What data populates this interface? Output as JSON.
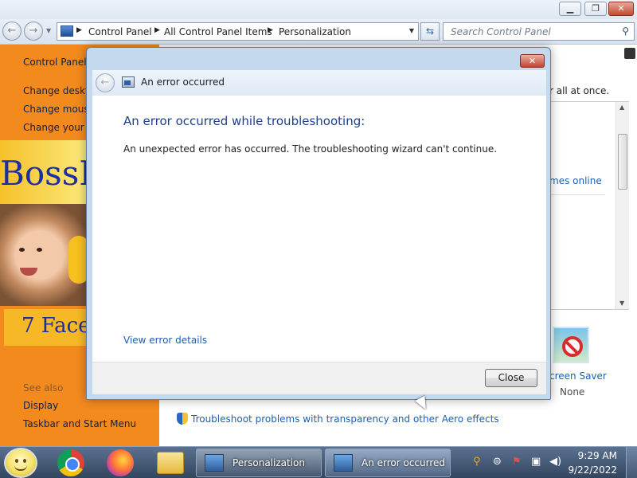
{
  "explorer": {
    "address_crumbs": [
      "Control Panel",
      "All Control Panel Items",
      "Personalization"
    ],
    "search_placeholder": "Search Control Panel",
    "left_pane": {
      "home_link": "Control Panel H",
      "links": [
        "Change deskto",
        "Change mouse",
        "Change your a"
      ],
      "see_also_label": "See also",
      "see_also_links": [
        "Display",
        "Taskbar and Start Menu"
      ]
    },
    "background_images": {
      "banner_top_text": "BossK",
      "banner_bottom_text": "7 Face"
    },
    "content": {
      "instruction_fragment": "r all at once.",
      "themes_online_fragment": "mes online",
      "screen_saver_label": "creen Saver",
      "screen_saver_value": "None",
      "troubleshoot_link": "Troubleshoot problems with transparency and other Aero effects"
    }
  },
  "dialog": {
    "title": "An error occurred",
    "heading": "An error occurred while troubleshooting:",
    "message": "An unexpected error has occurred. The troubleshooting wizard can't continue.",
    "details_link": "View error details",
    "close_button": "Close"
  },
  "taskbar": {
    "tasks": [
      "Personalization",
      "An error occurred"
    ],
    "clock_time": "9:29 AM",
    "clock_date": "9/22/2022"
  },
  "colors": {
    "left_pane_orange": "#f28a1d",
    "link_blue": "#1c5fb4",
    "heading_blue": "#1e3f8c"
  }
}
